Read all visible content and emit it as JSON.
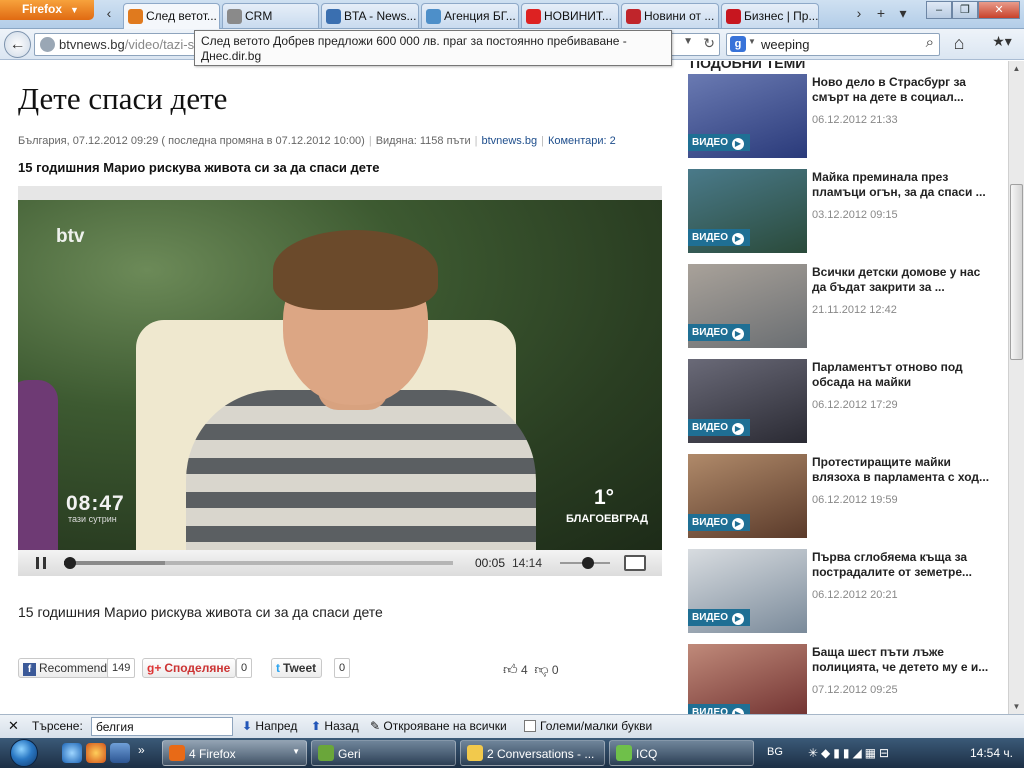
{
  "browser": {
    "menu_label": "Firefox",
    "tabs": [
      {
        "label": "След ветот...",
        "icon": "dnes-favicon",
        "color": "#e07a1e"
      },
      {
        "label": "CRM",
        "icon": "crm-favicon",
        "color": "#8a8a8a"
      },
      {
        "label": "BTA - News...",
        "icon": "bta-favicon",
        "color": "#3a6fb0"
      },
      {
        "label": "Агенция БГ...",
        "icon": "agency-favicon",
        "color": "#4d8fc9"
      },
      {
        "label": "НОВИНИТ...",
        "icon": "info-favicon",
        "color": "#d22"
      },
      {
        "label": "Новини от ...",
        "icon": "news-favicon",
        "color": "#c0252b"
      },
      {
        "label": "Бизнес | Пр...",
        "icon": "dnevnik-favicon",
        "color": "#c7161f"
      }
    ],
    "url_domain": "btvnews.bg",
    "url_path": "/video/tazi-su",
    "search_query": "weeping",
    "tooltip": "След ветото Добрев предложи 600 000 лв. праг за постоянно пребиваване - Днес.dir.bg"
  },
  "article": {
    "title": "Дете спаси дете",
    "meta_location_date": "България, 07.12.2012 09:29 ( последна промяна в 07.12.2012 10:00)",
    "meta_views": "Видяна: 1158 пъти",
    "meta_source": "btvnews.bg",
    "meta_comments": "Коментари: 2",
    "subtitle": "15 годишния Марио рискува живота си за да спаси дете",
    "caption": "15 годишния Марио рискува живота си за да спаси дете"
  },
  "player": {
    "channel_logo": "btv",
    "overlay_time": "08:47",
    "overlay_show": "тази сутрин",
    "overlay_temp": "1°",
    "overlay_city": "БЛАГОЕВГРАД",
    "current_time": "00:05",
    "total_time": "14:14",
    "progress_fraction": 0.006,
    "buffered_fraction": 0.26,
    "volume_fraction": 0.55
  },
  "share": {
    "recommend_label": "Recommend",
    "recommend_count": "149",
    "gplus_label": "Споделяне",
    "gplus_count": "0",
    "tweet_label": "Tweet",
    "tweet_count": "0",
    "likes": "4",
    "dislikes": "0"
  },
  "related": {
    "heading": "ПОДОБНИ ТЕМИ",
    "badge_label": "ВИДЕО",
    "items": [
      {
        "title": "Ново дело в Страсбург за смърт на дете в социал...",
        "date": "06.12.2012 21:33",
        "colors": [
          "#2a3a7a",
          "#6a7ab2"
        ]
      },
      {
        "title": "Майка преминала през пламъци огън, за да спаси ...",
        "date": "03.12.2012 09:15",
        "colors": [
          "#2a4a3a",
          "#4a7a8a"
        ]
      },
      {
        "title": "Всички детски домове у нас да бъдат закрити за ...",
        "date": "21.11.2012 12:42",
        "colors": [
          "#6a6e72",
          "#a9a29a"
        ]
      },
      {
        "title": "Парламентът отново под обсада на майки",
        "date": "06.12.2012 17:29",
        "colors": [
          "#2a2a33",
          "#6a6a78"
        ]
      },
      {
        "title": "Протестиращите майки влязоха в парламента с ход...",
        "date": "06.12.2012 19:59",
        "colors": [
          "#5a3a2a",
          "#b08a6a"
        ]
      },
      {
        "title": "Първа сглобяема къща за пострадалите от земетре...",
        "date": "06.12.2012 20:21",
        "colors": [
          "#7a8a9a",
          "#d8dce0"
        ]
      },
      {
        "title": "Баща шест пъти лъже полицията, че детето му е и...",
        "date": "07.12.2012 09:25",
        "colors": [
          "#6a2a2a",
          "#c08a7a"
        ]
      }
    ]
  },
  "findbar": {
    "label": "Търсене:",
    "value": "белгия",
    "next_label": "Напред",
    "prev_label": "Назад",
    "highlight_label": "Открояване на всички",
    "case_label": "Големи/малки букви"
  },
  "taskbar": {
    "tasks": [
      {
        "label": "4 Firefox",
        "color": "#e86a17"
      },
      {
        "label": "Geri",
        "color": "#6aa63a"
      },
      {
        "label": "2 Conversations - ...",
        "color": "#f2c94c"
      },
      {
        "label": "ICQ",
        "color": "#6fc04a"
      }
    ],
    "language": "BG",
    "clock": "14:54 ч."
  }
}
